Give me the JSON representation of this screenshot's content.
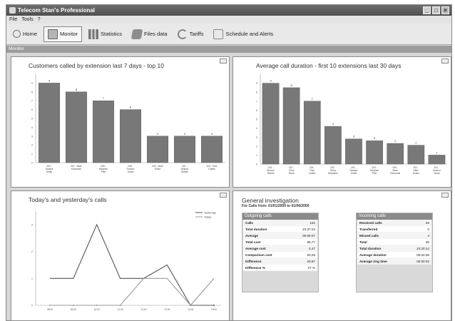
{
  "window": {
    "title": "Telecom Stan's Professional",
    "controls": [
      "minimize",
      "maximize",
      "close"
    ]
  },
  "menu": {
    "items": [
      "File",
      "Tools",
      "?"
    ]
  },
  "toolbar": {
    "items": [
      {
        "label": "Home",
        "icon": "home-icon",
        "active": false
      },
      {
        "label": "Monitor",
        "icon": "monitor-icon",
        "active": true
      },
      {
        "label": "Statistics",
        "icon": "statistics-icon",
        "active": false
      },
      {
        "label": "Files data",
        "icon": "files-data-icon",
        "active": false
      },
      {
        "label": "Tariffs",
        "icon": "tariffs-icon",
        "active": false
      },
      {
        "label": "Schedule and Alerts",
        "icon": "schedule-icon",
        "active": false
      }
    ]
  },
  "section": {
    "label": "Monitor"
  },
  "panels": {
    "customers": {
      "title": "Customers called by extension last 7 days - top 10"
    },
    "duration": {
      "title": "Average call duration - first 10 extensions last 30 days"
    },
    "calls": {
      "title": "Today's and yesterday's calls"
    },
    "investigation": {
      "title": "General investigation",
      "subtitle": "For Calls from: 01/01/2000 to 01/06/2000",
      "outgoing": {
        "header": "Outgoing calls",
        "rows": [
          {
            "label": "Calls",
            "value": "162"
          },
          {
            "label": "Total duration",
            "value": "24:37:23"
          },
          {
            "label": "Average",
            "value": "00:09:07"
          },
          {
            "label": "Total cost",
            "value": "99,77"
          },
          {
            "label": "Average cost",
            "value": "0,47"
          },
          {
            "label": "Comparison cost",
            "value": "83,05"
          },
          {
            "label": "Difference",
            "value": "29,67"
          },
          {
            "label": "Difference %",
            "value": "27 %"
          }
        ]
      },
      "incoming": {
        "header": "Incoming calls",
        "rows": [
          {
            "label": "Received calls",
            "value": "26"
          },
          {
            "label": "Transferred",
            "value": "0"
          },
          {
            "label": "Missed calls",
            "value": "4"
          },
          {
            "label": "Total",
            "value": "30"
          },
          {
            "label": "Total duration",
            "value": "24:20:14"
          },
          {
            "label": "Average duration",
            "value": "00:02:06"
          },
          {
            "label": "Average ring time",
            "value": "00:00:03"
          }
        ]
      }
    }
  },
  "colors": {
    "bar": "#787878",
    "line_a": "#555555",
    "line_b": "#9a9a9a"
  },
  "chart_data": [
    {
      "type": "bar",
      "title": "Customers called by extension last 7 days - top 10",
      "categories": [
        "202 - Sandra Smith",
        "207 - Mark Edmonds",
        "208 - Stephen Pike",
        "205 - Gordon Jones",
        "203 - Mark Grant",
        "201 - Sharon Skeels",
        "204 - Paul Coffee"
      ],
      "values": [
        9,
        8,
        7,
        6,
        3,
        3,
        3
      ],
      "ylim": [
        0,
        10
      ],
      "yticks": [
        "0",
        "1",
        "2",
        "3",
        "4",
        "5",
        "6",
        "7",
        "8",
        "9"
      ]
    },
    {
      "type": "bar",
      "title": "Average call duration - first 10 extensions last 30 days",
      "categories": [
        "216 - Sharon Skeels",
        "207 - Chris Read",
        "204 - Paul Coffee",
        "202 - Gerry Stephens",
        "201 - Sandra Smith",
        "203 - Stephen Pike",
        "205 - Mark Edmonds",
        "202 - Mike Evans",
        "201 - Gordon Jones"
      ],
      "values": [
        9,
        8.5,
        7,
        4.2,
        2.8,
        2.6,
        2.3,
        2.1,
        1
      ],
      "labels": [
        "9",
        "8",
        "7",
        "4",
        "3",
        "3",
        "2",
        "2",
        "1"
      ],
      "ylim": [
        0,
        10
      ],
      "yticks": [
        "0",
        "1",
        "2",
        "3",
        "4",
        "5",
        "6",
        "7",
        "8",
        "9"
      ]
    },
    {
      "type": "line",
      "title": "Today's and yesterday's calls",
      "x": [
        "08:00",
        "09:00",
        "10:00",
        "11:00",
        "12:00",
        "13:00",
        "14:00",
        "15:00"
      ],
      "series": [
        {
          "name": "Yesterday",
          "values": [
            1,
            1,
            3,
            1,
            1,
            1.5,
            0,
            0
          ]
        },
        {
          "name": "Today",
          "values": [
            0,
            0,
            0,
            0,
            1,
            1,
            0,
            1
          ]
        }
      ],
      "ylim": [
        0,
        3.5
      ],
      "yticks": [
        "0",
        "1",
        "2",
        "3"
      ],
      "legend": "top-right"
    }
  ]
}
